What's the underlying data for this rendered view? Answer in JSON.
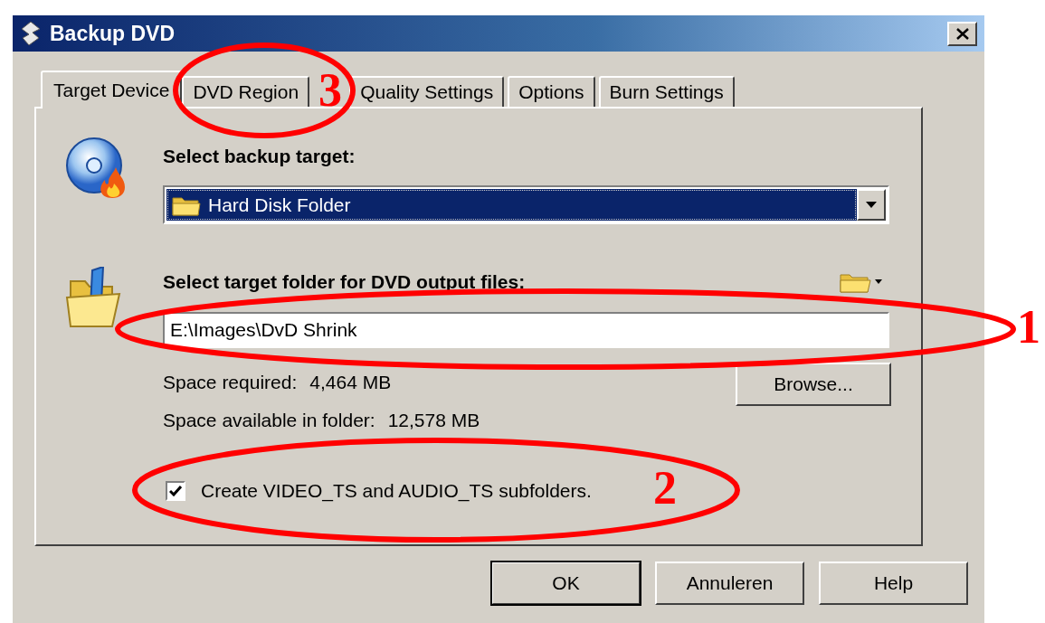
{
  "window": {
    "title": "Backup DVD"
  },
  "tabs": [
    {
      "label": "Target Device",
      "selected": true
    },
    {
      "label": "DVD Region",
      "selected": false
    },
    {
      "label": "Quality Settings",
      "selected": false
    },
    {
      "label": "Options",
      "selected": false
    },
    {
      "label": "Burn Settings",
      "selected": false
    }
  ],
  "backup_target": {
    "label": "Select backup target:",
    "value": "Hard Disk Folder"
  },
  "target_folder": {
    "label": "Select target folder for DVD output files:",
    "value": "E:\\Images\\DvD Shrink"
  },
  "space": [
    {
      "label": "Space required:",
      "value": "4,464 MB"
    },
    {
      "label": "Space available in folder:",
      "value": "12,578 MB"
    }
  ],
  "browse_button": "Browse...",
  "checkbox": {
    "label": "Create VIDEO_TS and AUDIO_TS subfolders.",
    "checked": true
  },
  "buttons": [
    {
      "label": "OK",
      "default": true
    },
    {
      "label": "Annuleren",
      "default": false
    },
    {
      "label": "Help",
      "default": false
    }
  ],
  "annotations": [
    {
      "number": "1"
    },
    {
      "number": "2"
    },
    {
      "number": "3"
    }
  ]
}
